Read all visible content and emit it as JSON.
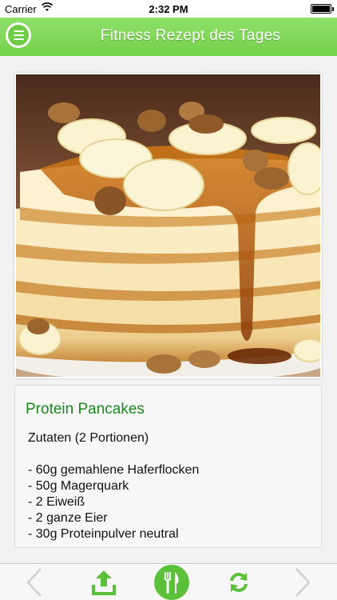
{
  "status_bar": {
    "carrier": "Carrier",
    "time": "2:32 PM"
  },
  "nav": {
    "title": "Fitness Rezept des Tages"
  },
  "recipe": {
    "title": "Protein Pancakes",
    "lines": [
      "Zutaten (2 Portionen)",
      "- 60g gemahlene Haferflocken",
      "- 50g Magerquark",
      "- 2 Eiweiß",
      "- 2 ganze Eier",
      "- 30g Proteinpulver neutral"
    ]
  },
  "image": {
    "subject": "pancake stack with banana slices, walnuts and syrup"
  },
  "toolbar": {
    "items": [
      "chevron-left-icon",
      "share-icon",
      "fork-knife-icon",
      "refresh-icon",
      "chevron-right-icon"
    ]
  },
  "colors": {
    "accent": "#73d14a",
    "title_green": "#1b8a1b",
    "icon_green": "#5cc13a"
  }
}
